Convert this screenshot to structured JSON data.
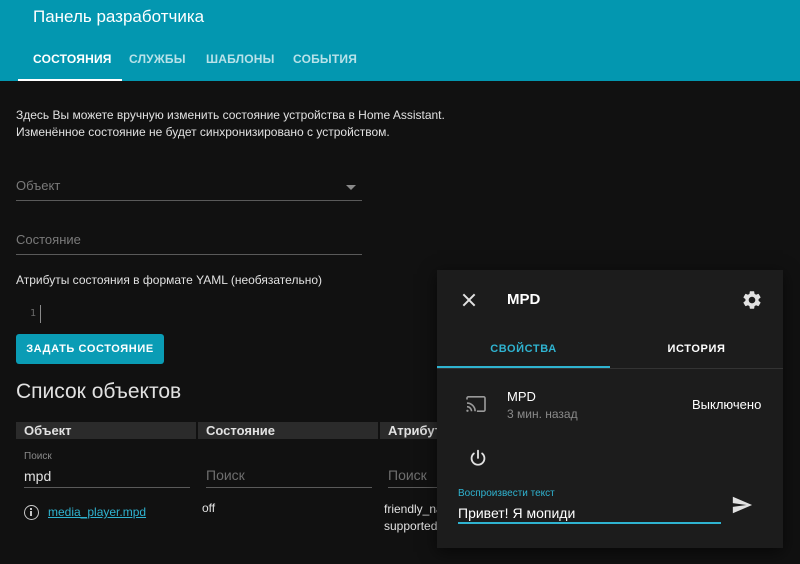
{
  "header": {
    "title": "Панель разработчика",
    "tabs": [
      {
        "label": "СОСТОЯНИЯ"
      },
      {
        "label": "СЛУЖБЫ"
      },
      {
        "label": "ШАБЛОНЫ"
      },
      {
        "label": "СОБЫТИЯ"
      }
    ]
  },
  "main": {
    "description_line1": "Здесь Вы можете вручную изменить состояние устройства в Home Assistant.",
    "description_line2": "Изменённое состояние не будет синхронизировано с устройством.",
    "object_placeholder": "Объект",
    "state_placeholder": "Состояние",
    "yaml_label": "Атрибуты состояния в формате YAML (необязательно)",
    "yaml_line_number": "1",
    "set_button": "ЗАДАТЬ СОСТОЯНИЕ"
  },
  "entity_list": {
    "title": "Список объектов",
    "columns": [
      "Объект",
      "Состояние",
      "Атрибуты"
    ],
    "filter_label": "Поиск",
    "filter_value": "mpd",
    "filter_placeholder": "Поиск",
    "rows": [
      {
        "entity": "media_player.mpd",
        "state": "off",
        "attr_line1": "friendly_name",
        "attr_line2": "supported_features"
      }
    ]
  },
  "dialog": {
    "title": "MPD",
    "tabs": [
      "СВОЙСТВА",
      "ИСТОРИЯ"
    ],
    "entity_name": "MPD",
    "last_changed": "3 мин. назад",
    "state": "Выключено",
    "tts_label": "Воспроизвести текст",
    "tts_value": "Привет! Я мопиди"
  },
  "colors": {
    "header": "#0397b0",
    "accent": "#2fb3d0",
    "background": "#111111",
    "dialog": "#1c1c1c"
  }
}
